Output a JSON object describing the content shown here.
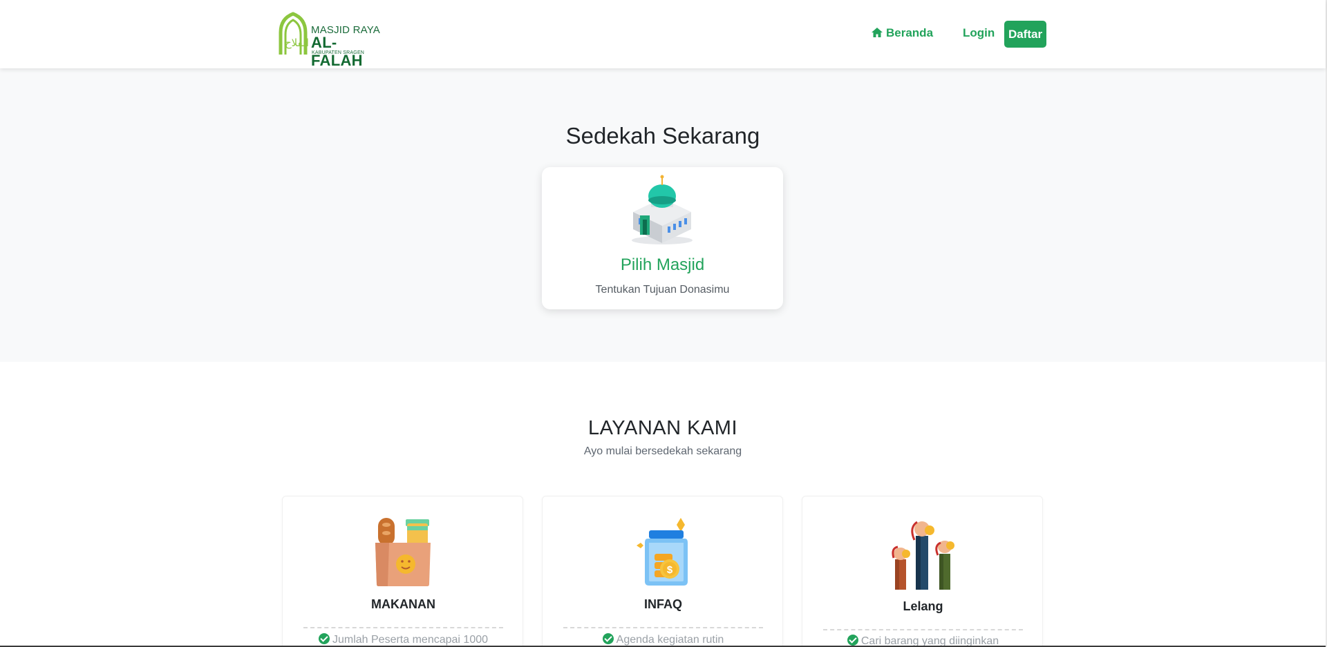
{
  "navbar": {
    "logo": {
      "line1": "MASJID RAYA",
      "line2": "AL-FALAH",
      "line3": "KABUPATEN SRAGEN",
      "arabic": "الفلاح"
    },
    "links": {
      "home": "Beranda",
      "login": "Login",
      "register": "Daftar"
    },
    "icons": {
      "home": "home-icon"
    }
  },
  "hero": {
    "title": "Sedekah Sekarang",
    "card": {
      "title": "Pilih Masjid",
      "subtitle": "Tentukan Tujuan Donasimu",
      "icon": "mosque-icon"
    }
  },
  "services": {
    "title": "LAYANAN KAMI",
    "subtitle": "Ayo mulai bersedekah sekarang",
    "items": [
      {
        "name": "MAKANAN",
        "icon": "grocery-bag-icon",
        "feature": "Jumlah Peserta mencapai 1000"
      },
      {
        "name": "INFAQ",
        "icon": "coin-jar-icon",
        "feature": "Agenda kegiatan rutin"
      },
      {
        "name": "Lelang",
        "icon": "auction-hands-icon",
        "feature": "Cari barang yang diinginkan"
      }
    ]
  },
  "colors": {
    "accent": "#22a35b",
    "hero_bg": "#f8f9fa",
    "logo_green": "#136a32",
    "logo_lime": "#8cc63f"
  }
}
